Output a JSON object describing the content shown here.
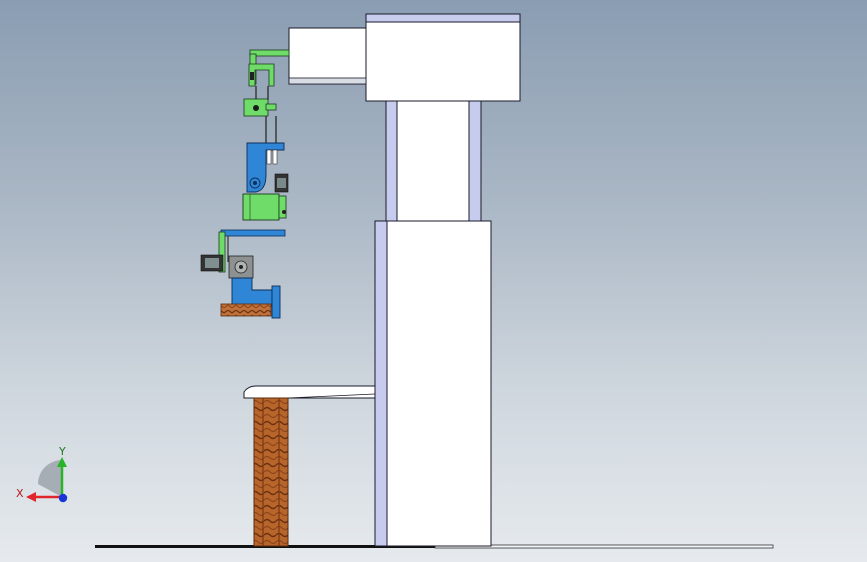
{
  "triad": {
    "x_label": "X",
    "y_label": "Y",
    "x_color": "#e0262a",
    "y_color": "#27b427",
    "z_color": "#1836d8"
  },
  "colors": {
    "background_top": "#8a9db2",
    "background_bottom": "#e6eaee",
    "panel_fill": "#ffffff",
    "panel_edge": "#1a1a2a",
    "rail_fill": "#c7ccee",
    "arm_blue": "#2f85d6",
    "bracket_green": "#6fdc6a",
    "workpiece_brown": "#b5622a"
  }
}
